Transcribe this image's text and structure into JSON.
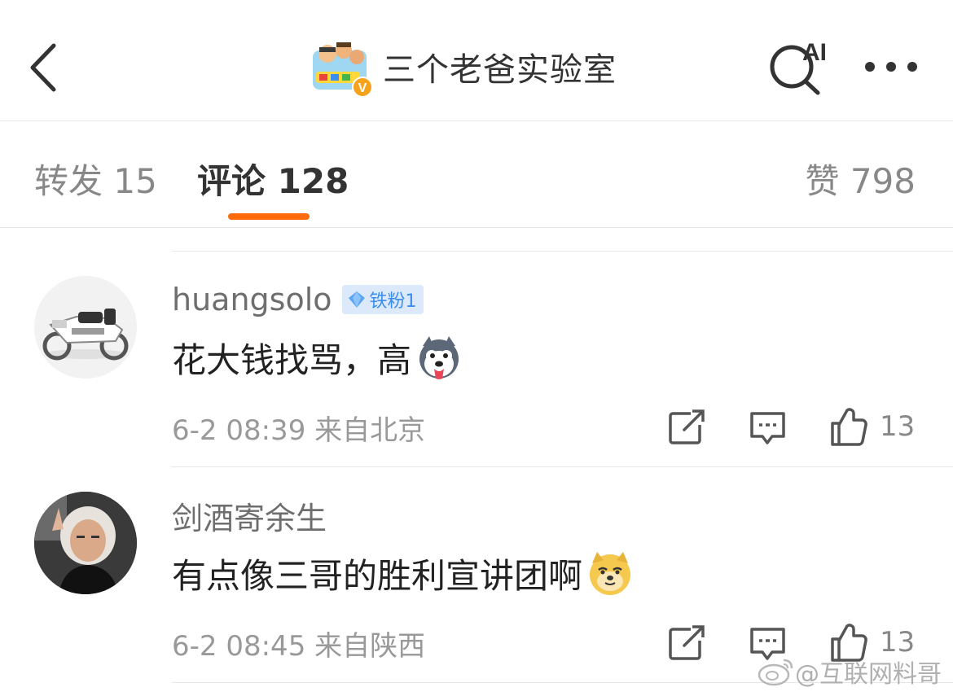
{
  "header": {
    "back_icon": "chevron-left-icon",
    "title": "三个老爸实验室",
    "ai_label": "AI",
    "verified_badge": "V"
  },
  "tabs": {
    "repost": "转发 15",
    "comment": "评论 128",
    "like": "赞 798",
    "accent_color": "#ff6b0a"
  },
  "comments": [
    {
      "user": "huangsolo",
      "badge": "铁粉1",
      "text": "花大钱找骂，高",
      "emoji": "husky-emoji",
      "time": "6-2 08:39",
      "location": "来自北京",
      "likes": "13"
    },
    {
      "user": "剑酒寄余生",
      "text": "有点像三哥的胜利宣讲团啊",
      "emoji": "doge-emoji",
      "time": "6-2 08:45",
      "location": "来自陕西",
      "likes": "13"
    }
  ],
  "watermark": "@互联网料哥"
}
